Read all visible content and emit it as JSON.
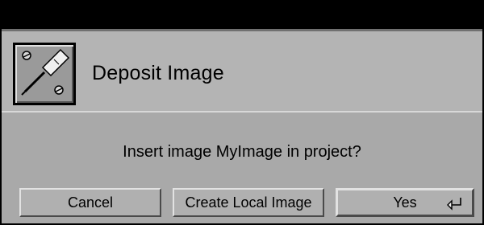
{
  "dialog": {
    "title": "Deposit Image",
    "icon": "wrench-screwdriver-tool-icon",
    "message": "Insert image MyImage in project?"
  },
  "buttons": {
    "cancel_label": "Cancel",
    "create_label": "Create Local Image",
    "yes_label": "Yes",
    "default_key_icon": "enter-key-icon"
  }
}
